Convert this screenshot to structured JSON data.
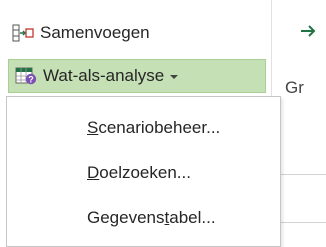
{
  "ribbon": {
    "merge_button": {
      "label": "Samenvoegen",
      "icon": "merge-cells-icon"
    },
    "whatif_button": {
      "label": "Wat-als-analyse",
      "icon": "what-if-analysis-icon",
      "dropdown_icon": "chevron-down-icon"
    },
    "right_icon": "arrow-right-icon",
    "group_label_partial": "Gr"
  },
  "menu": {
    "items": [
      {
        "prefix": "",
        "underlined": "S",
        "suffix": "cenariobeheer..."
      },
      {
        "prefix": "",
        "underlined": "D",
        "suffix": "oelzoeken..."
      },
      {
        "prefix": "Gegevens",
        "underlined": "t",
        "suffix": "abel..."
      }
    ]
  },
  "colors": {
    "active_button_bg": "#c5e0b4",
    "active_button_border": "#a9cf92",
    "text": "#262626",
    "menu_border": "#c6c6c6",
    "arrow_green": "#217346"
  }
}
